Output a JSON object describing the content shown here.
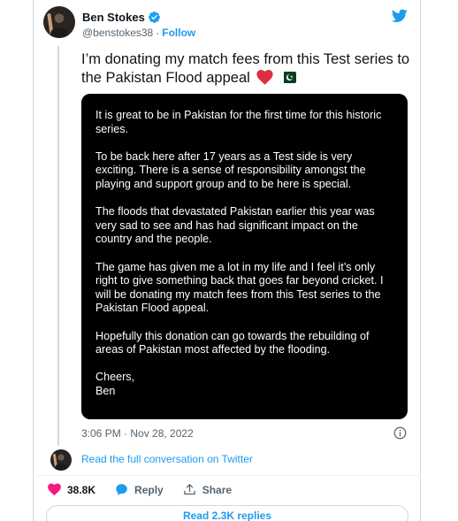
{
  "author": {
    "name": "Ben Stokes",
    "handle": "@benstokes38",
    "separator": "·",
    "follow_label": "Follow"
  },
  "tweet": {
    "text": "I’m donating my match fees from this Test series to the Pakistan Flood appeal",
    "emoji": [
      "red-heart",
      "pakistan-flag"
    ]
  },
  "statement": {
    "paragraphs": [
      "It is great to be in Pakistan for the first time for this historic series.",
      "To be back here after 17 years as a Test side is very exciting. There is a sense of responsibility amongst the playing and support group and to be here is special.",
      "The floods that devastated Pakistan earlier this year was very sad to see and has had significant impact on the country and the people.",
      "The game has given me a lot in my life and I feel it’s only right to give something back that goes far beyond cricket. I will be donating my match fees from this Test series to the Pakistan Flood appeal.",
      "Hopefully this donation can go towards the rebuilding of areas of Pakistan most affected by the flooding.",
      "Cheers,\nBen"
    ]
  },
  "timestamp": "3:06 PM · Nov 28, 2022",
  "read_conversation": "Read the full conversation on Twitter",
  "actions": {
    "likes": "38.8K",
    "reply_label": "Reply",
    "share_label": "Share"
  },
  "read_replies": "Read 2.3K replies",
  "colors": {
    "accent": "#1d9bf0",
    "like": "#f91880",
    "text_secondary": "#536471"
  }
}
